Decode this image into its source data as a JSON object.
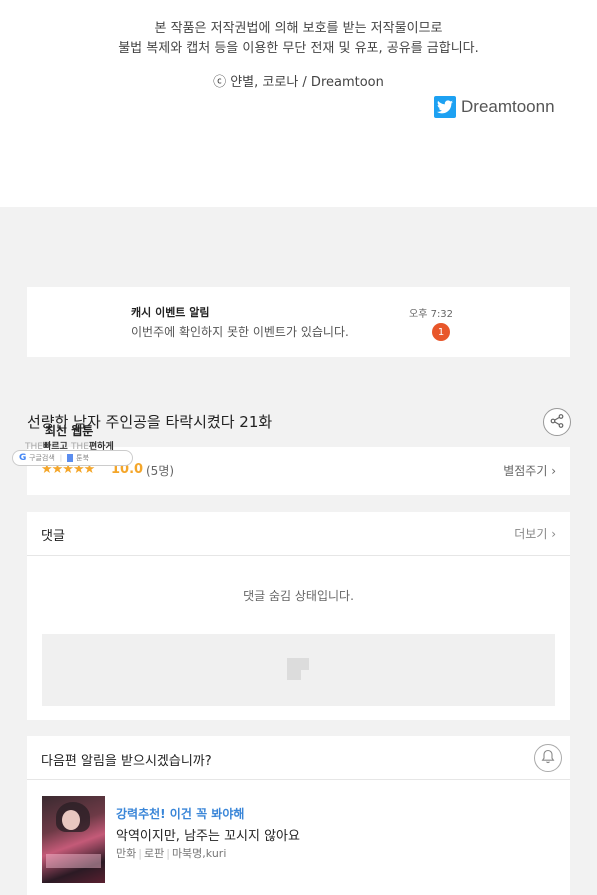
{
  "copyright": {
    "notice_line1": "본 작품은 저작권법에 의해 보호를 받는 저작물이므로",
    "notice_line2": "불법 복제와 캡처 등을 이용한 무단 전재 및 유포, 공유를 금합니다.",
    "credit": "ⓒ 얀별, 코로나 / Dreamtoon",
    "twitter_handle": "Dreamtoonn",
    "twitter_color": "#1da1f2"
  },
  "event_alert": {
    "title": "캐시 이벤트 알림",
    "description": "이번주에 확인하지 못한 이벤트가 있습니다.",
    "time": "오후 7:32",
    "count": "1",
    "badge_color": "#e8562a"
  },
  "episode": {
    "title": "선량한 남자 주인공을 타락시켰다 21화",
    "share_icon": "share-icon"
  },
  "overlay": {
    "title": "최신 웹툰",
    "sub_prefix_1": "THE",
    "sub_text_1": "빠르고",
    "sub_prefix_2": "THE",
    "sub_text_2": "편하게",
    "chip_google": "G",
    "chip_label_1": "구글검색",
    "chip_label_2": "툰북"
  },
  "rating": {
    "stars": "★★★★★",
    "score": "10.0",
    "count": "(5명)",
    "rate_link": "별점주기 ›",
    "accent_color": "#f4a62a"
  },
  "comments": {
    "title": "댓글",
    "more_link": "더보기 ›",
    "hidden_message": "댓글 숨김 상태입니다."
  },
  "notify": {
    "question": "다음편 알림을 받으시겠습니까?",
    "bell_icon": "bell-icon"
  },
  "recommendation": {
    "tag": "강력추천! 이건 꼭 봐야해",
    "title": "악역이지만, 남주는 꼬시지 않아요",
    "genre": "만화",
    "format": "로판",
    "authors": "마북명,kuri",
    "tag_color": "#3a86d8"
  }
}
